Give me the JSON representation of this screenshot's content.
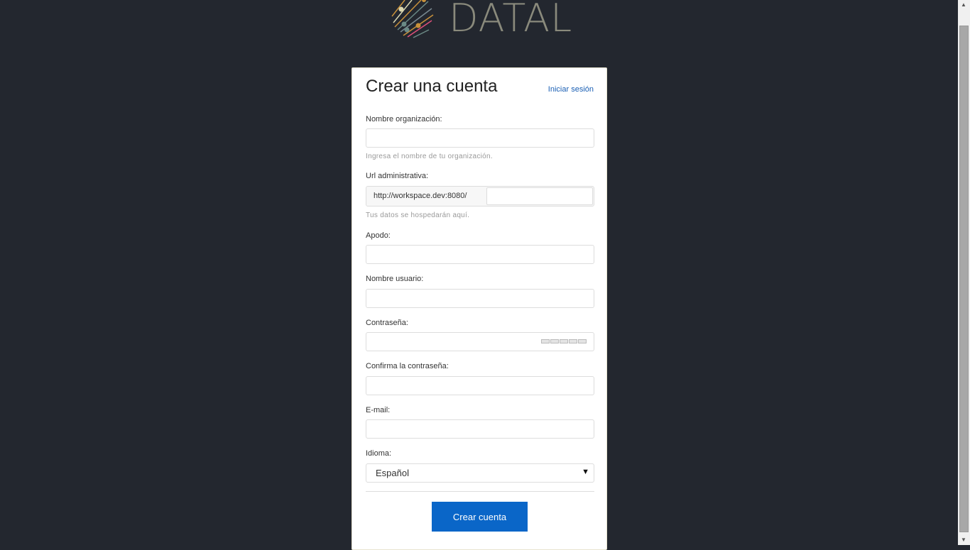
{
  "logo": {
    "text": "DATAL"
  },
  "card": {
    "title": "Crear una cuenta",
    "signin_link": "Iniciar sesión",
    "fields": {
      "org": {
        "label": "Nombre organización:",
        "value": "",
        "help": "Ingresa el nombre de tu organización."
      },
      "url": {
        "label": "Url administrativa:",
        "prefix": "http://workspace.dev:8080/",
        "value": "",
        "help": "Tus datos se hospedarán aquí."
      },
      "nick": {
        "label": "Apodo:",
        "value": ""
      },
      "username": {
        "label": "Nombre usuario:",
        "value": ""
      },
      "password": {
        "label": "Contraseña:",
        "value": ""
      },
      "confirm": {
        "label": "Confirma la contraseña:",
        "value": ""
      },
      "email": {
        "label": "E-mail:",
        "value": ""
      },
      "language": {
        "label": "Idioma:",
        "selected": "Español"
      }
    },
    "submit": "Crear cuenta"
  },
  "colors": {
    "background": "#23272f",
    "accent": "#0a66c8"
  }
}
